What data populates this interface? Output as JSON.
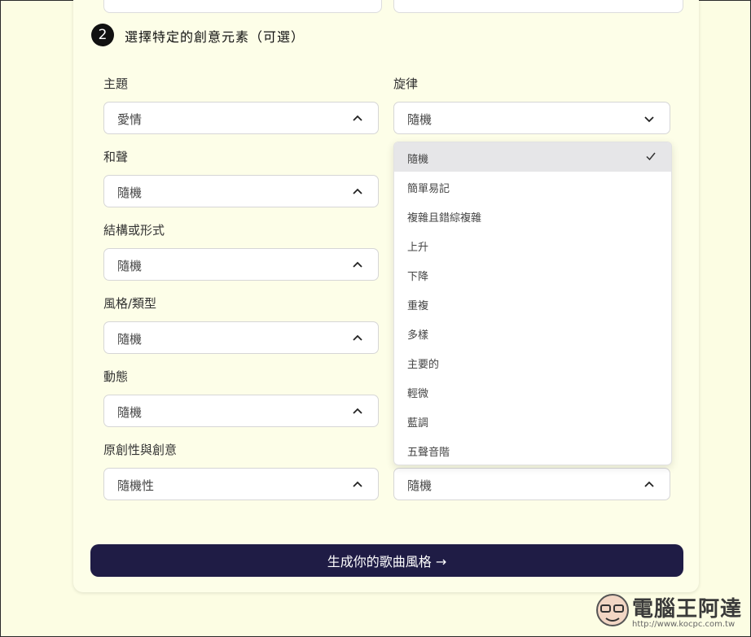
{
  "section": {
    "step_number": "2",
    "title": "選擇特定的創意元素（可選）"
  },
  "fields": [
    {
      "label": "主題",
      "value": "愛情"
    },
    {
      "label": "旋律",
      "value": "隨機"
    },
    {
      "label": "和聲",
      "value": "隨機"
    },
    {
      "label": "結構或形式",
      "value": "隨機"
    },
    {
      "label": "風格/類型",
      "value": "隨機"
    },
    {
      "label": "動態",
      "value": "隨機"
    },
    {
      "label": "原創性與創意",
      "value": "隨機性"
    },
    {
      "label": "",
      "value": "隨機"
    }
  ],
  "melody_dropdown": {
    "selected": "隨機",
    "options": [
      "隨機",
      "簡單易記",
      "複雜且錯綜複雜",
      "上升",
      "下降",
      "重複",
      "多樣",
      "主要的",
      "輕微",
      "藍調",
      "五聲音階"
    ]
  },
  "generate_button": {
    "label": "生成你的歌曲風格 →"
  },
  "watermark": {
    "brand": "電腦王阿達",
    "url": "http://www.kocpc.com.tw"
  },
  "colors": {
    "page_bg": "#fcfde3",
    "button_bg": "#1f1c45",
    "selected_option_bg": "#e6e6e8"
  }
}
